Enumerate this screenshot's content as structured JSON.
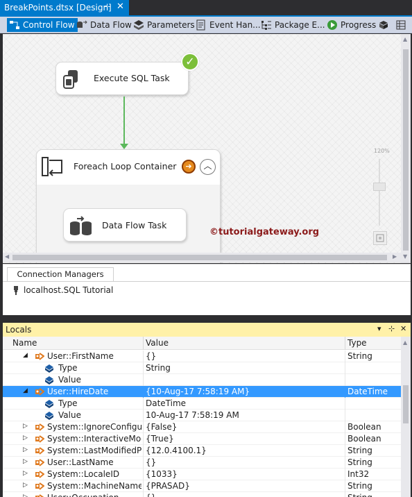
{
  "document_tab": {
    "title": "BreakPoints.dtsx [Design]",
    "pin": "⊹",
    "close": "✕"
  },
  "designer_tabs": [
    {
      "label": "Control Flow",
      "icon": "control-flow-icon"
    },
    {
      "label": "Data Flow",
      "icon": "data-flow-icon"
    },
    {
      "label": "Parameters",
      "icon": "parameters-icon"
    },
    {
      "label": "Event Han...",
      "icon": "event-handlers-icon"
    },
    {
      "label": "Package E...",
      "icon": "package-explorer-icon"
    },
    {
      "label": "Progress",
      "icon": "progress-icon"
    }
  ],
  "designer": {
    "execute_sql_task": "Execute SQL Task",
    "foreach_container": "Foreach Loop Container",
    "data_flow_task": "Data Flow Task",
    "watermark": "©tutorialgateway.org",
    "zoom_label": "120%"
  },
  "connection_managers": {
    "tab_label": "Connection Managers",
    "items": [
      "localhost.SQL Tutorial"
    ]
  },
  "locals": {
    "title": "Locals",
    "controls": {
      "dropdown": "▾",
      "pin": "⊹",
      "close": "✕"
    },
    "columns": {
      "name": "Name",
      "value": "Value",
      "type": "Type"
    },
    "rows": [
      {
        "name": "User::FirstName",
        "value": "{}",
        "type": "String",
        "level": 1,
        "expander": "◢",
        "icon": "variable-icon"
      },
      {
        "name": "Type",
        "value": "String",
        "type": "",
        "level": 2,
        "expander": "",
        "icon": "property-icon"
      },
      {
        "name": "Value",
        "value": "",
        "type": "",
        "level": 2,
        "expander": "",
        "icon": "property-icon"
      },
      {
        "name": "User::HireDate",
        "value": "{10-Aug-17 7:58:19 AM}",
        "type": "DateTime",
        "level": 1,
        "expander": "◢",
        "icon": "variable-icon",
        "selected": true
      },
      {
        "name": "Type",
        "value": "DateTime",
        "type": "",
        "level": 2,
        "expander": "",
        "icon": "property-icon"
      },
      {
        "name": "Value",
        "value": "10-Aug-17 7:58:19 AM",
        "type": "",
        "level": 2,
        "expander": "",
        "icon": "property-icon"
      },
      {
        "name": "System::IgnoreConfigurat",
        "value": "{False}",
        "type": "Boolean",
        "level": 1,
        "expander": "▷",
        "icon": "variable-icon"
      },
      {
        "name": "System::InteractiveMode",
        "value": "{True}",
        "type": "Boolean",
        "level": 1,
        "expander": "▷",
        "icon": "variable-icon"
      },
      {
        "name": "System::LastModifiedProc",
        "value": "{12.0.4100.1}",
        "type": "String",
        "level": 1,
        "expander": "▷",
        "icon": "variable-icon"
      },
      {
        "name": "User::LastName",
        "value": "{}",
        "type": "String",
        "level": 1,
        "expander": "▷",
        "icon": "variable-icon"
      },
      {
        "name": "System::LocaleID",
        "value": "{1033}",
        "type": "Int32",
        "level": 1,
        "expander": "▷",
        "icon": "variable-icon"
      },
      {
        "name": "System::MachineName",
        "value": "{PRASAD}",
        "type": "String",
        "level": 1,
        "expander": "▷",
        "icon": "variable-icon"
      },
      {
        "name": "User::Occupation",
        "value": "{}",
        "type": "String",
        "level": 1,
        "expander": "▷",
        "icon": "variable-icon"
      }
    ]
  },
  "colors": {
    "accent": "#007acc",
    "selection": "#3399ff",
    "locals_header": "#fff1a8",
    "success": "#7cbf3a"
  }
}
